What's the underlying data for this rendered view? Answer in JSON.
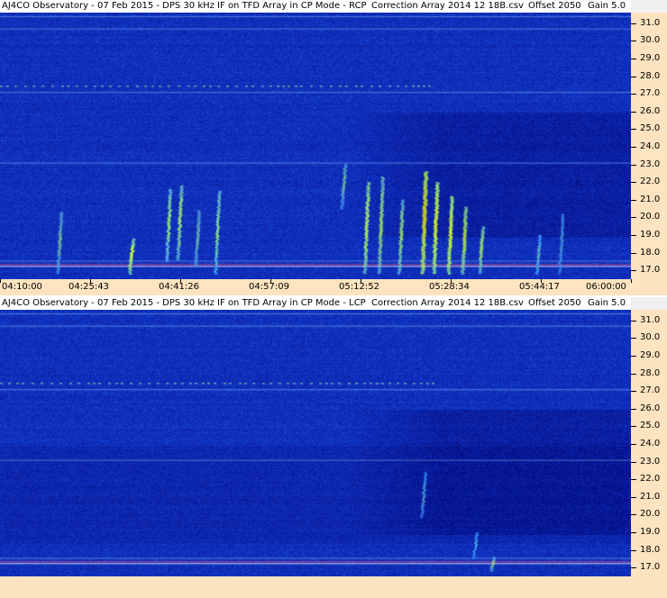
{
  "panels": [
    {
      "title": {
        "observatory": "AJ4CO Observatory - 07 Feb 2015 - DPS 30 kHz IF on TFD Array in CP Mode - RCP",
        "correction": "Correction Array 2014 12 18B.csv",
        "offset": "Offset 2050",
        "gain": "Gain 5.0"
      },
      "polarization": "RCP"
    },
    {
      "title": {
        "observatory": "AJ4CO Observatory - 07 Feb 2015 - DPS 30 kHz IF on TFD Array in CP Mode - LCP",
        "correction": "Correction Array 2014 12 18B.csv",
        "offset": "Offset 2050",
        "gain": "Gain 5.0"
      },
      "polarization": "LCP"
    }
  ],
  "chart_data": {
    "type": "heatmap",
    "x_tick_labels": [
      "04:10:00",
      "04:25:43",
      "04:41:26",
      "04:57:09",
      "05:12:52",
      "05:28:34",
      "05:44:17",
      "06:00:00"
    ],
    "y_tick_labels": [
      "31.0",
      "30.0",
      "29.0",
      "28.0",
      "27.0",
      "26.0",
      "25.0",
      "24.0",
      "23.0",
      "22.0",
      "21.0",
      "20.0",
      "19.0",
      "18.0",
      "17.0"
    ],
    "xlim": [
      "04:10:00",
      "06:00:00"
    ],
    "ylim": [
      16.5,
      31.6
    ],
    "colormap": [
      "#00007a",
      "#1a3fd0",
      "#4fa8ff",
      "#c8ff40",
      "#ffff00"
    ],
    "bursts_rcp": [
      {
        "t": "04:20:30",
        "f_low": 16.8,
        "f_high": 20.3,
        "intensity": 0.5
      },
      {
        "t": "04:33:00",
        "f_low": 16.8,
        "f_high": 18.8,
        "intensity": 0.7
      },
      {
        "t": "04:39:30",
        "f_low": 17.5,
        "f_high": 21.6,
        "intensity": 0.55
      },
      {
        "t": "04:41:26",
        "f_low": 17.6,
        "f_high": 21.8,
        "intensity": 0.6
      },
      {
        "t": "04:44:30",
        "f_low": 17.2,
        "f_high": 20.4,
        "intensity": 0.5
      },
      {
        "t": "04:48:00",
        "f_low": 16.8,
        "f_high": 21.5,
        "intensity": 0.5
      },
      {
        "t": "05:10:00",
        "f_low": 20.5,
        "f_high": 23.0,
        "intensity": 0.5
      },
      {
        "t": "05:14:00",
        "f_low": 16.8,
        "f_high": 22.0,
        "intensity": 0.7
      },
      {
        "t": "05:16:30",
        "f_low": 16.8,
        "f_high": 22.3,
        "intensity": 0.65
      },
      {
        "t": "05:20:00",
        "f_low": 16.8,
        "f_high": 21.0,
        "intensity": 0.6
      },
      {
        "t": "05:24:00",
        "f_low": 16.8,
        "f_high": 22.6,
        "intensity": 1.0
      },
      {
        "t": "05:26:00",
        "f_low": 16.8,
        "f_high": 22.0,
        "intensity": 0.85
      },
      {
        "t": "05:28:34",
        "f_low": 16.8,
        "f_high": 21.2,
        "intensity": 0.8
      },
      {
        "t": "05:31:00",
        "f_low": 16.8,
        "f_high": 20.6,
        "intensity": 0.75
      },
      {
        "t": "05:34:00",
        "f_low": 16.8,
        "f_high": 19.5,
        "intensity": 0.6
      },
      {
        "t": "05:44:00",
        "f_low": 16.8,
        "f_high": 19.0,
        "intensity": 0.4
      },
      {
        "t": "05:48:00",
        "f_low": 16.8,
        "f_high": 20.2,
        "intensity": 0.35
      }
    ],
    "bursts_lcp": [
      {
        "t": "05:24:00",
        "f_low": 19.8,
        "f_high": 22.4,
        "intensity": 0.35
      },
      {
        "t": "05:33:00",
        "f_low": 17.5,
        "f_high": 19.0,
        "intensity": 0.3
      },
      {
        "t": "05:36:00",
        "f_low": 16.8,
        "f_high": 17.6,
        "intensity": 0.55
      }
    ]
  }
}
